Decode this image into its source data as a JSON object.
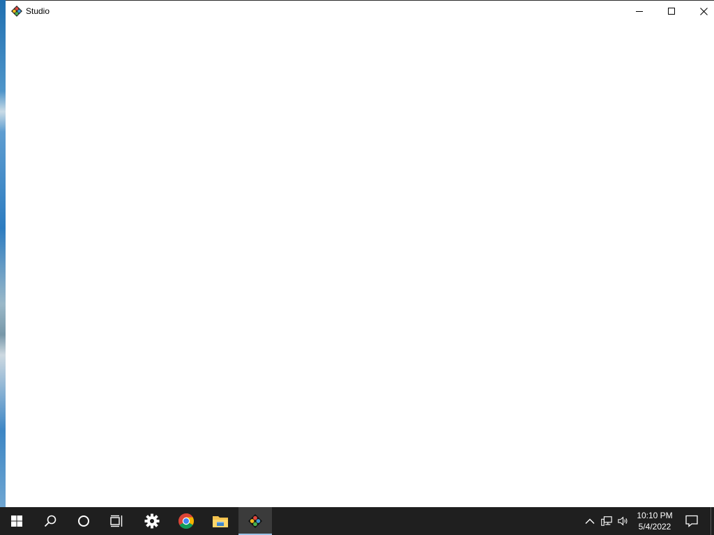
{
  "window": {
    "title": "Studio",
    "icon": "studio-app-icon",
    "controls": [
      "minimize-icon",
      "maximize-icon",
      "close-icon"
    ]
  },
  "taskbar": {
    "buttons": [
      {
        "name": "start",
        "icon": "windows-logo-icon"
      },
      {
        "name": "search",
        "icon": "search-icon"
      },
      {
        "name": "cortana",
        "icon": "circle-icon"
      },
      {
        "name": "task-view",
        "icon": "task-view-icon"
      },
      {
        "name": "settings",
        "icon": "gear-icon"
      },
      {
        "name": "chrome",
        "icon": "chrome-icon"
      },
      {
        "name": "file-explorer",
        "icon": "folder-icon"
      },
      {
        "name": "studio",
        "icon": "studio-app-icon",
        "active": true
      }
    ],
    "tray": {
      "icons": [
        "chevron-up-icon",
        "network-icon",
        "volume-icon"
      ],
      "time": "10:10 PM",
      "date": "5/4/2022",
      "notification_icon": "action-center-icon"
    }
  },
  "colors": {
    "taskbar_bg": "#1f1f1f",
    "active_indicator": "#9cc3e6",
    "window_bg": "#ffffff"
  }
}
